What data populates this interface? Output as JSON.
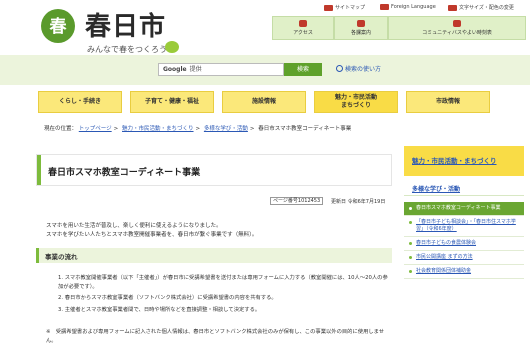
{
  "header": {
    "logo_glyph": "春",
    "title": "春日市",
    "tagline": "みんなで春をつくろう",
    "top_links": [
      {
        "label": "サイトマップ",
        "icon": "sitemap-icon"
      },
      {
        "label": "Foreign Language",
        "icon": "globe-icon"
      },
      {
        "label": "文字サイズ・配色の変更",
        "icon": "text-size-icon"
      }
    ],
    "top_buttons": [
      {
        "label": "アクセス",
        "icon": "map-pin-icon"
      },
      {
        "label": "各課案内",
        "icon": "building-icon"
      },
      {
        "label": "コミュニティバスやよい時刻表",
        "icon": "bus-icon"
      }
    ]
  },
  "search": {
    "brand": "Google",
    "placeholder": "提供",
    "button_label": "検索",
    "help_label": "検索の使い方"
  },
  "nav": [
    {
      "label": "くらし・手続き",
      "active": false
    },
    {
      "label": "子育て・健康・福祉",
      "active": false
    },
    {
      "label": "施設情報",
      "active": false
    },
    {
      "label": "魅力・市民活動\nまちづくり",
      "active": true
    },
    {
      "label": "市政情報",
      "active": false
    }
  ],
  "breadcrumb": {
    "prefix": "現在の位置：",
    "items": [
      "トップページ",
      "魅力・市民活動・まちづくり",
      "多様な学び・活動",
      "春日市スマホ教室コーディネート事業"
    ]
  },
  "main": {
    "title": "春日市スマホ教室コーディネート事業",
    "page_id": "ページ番号1012453",
    "updated": "更新日 令和6年7月19日",
    "intro_lines": [
      "スマホを用いた生活が普及し、楽しく便利に使えるようになりました。",
      "スマホを学びたい人たちとスマホ教室開催事業者を、春日市が繋ぐ事業です（無料）。"
    ],
    "section_heading": "事業の流れ",
    "steps": [
      "1. スマホ教室開催事業者（以下「主催者」）が春日市に受講希望書を送付または専用フォームに入力する（教室開催には、10人～20人の参加が必要です）。",
      "2. 春日市からスマホ教室事業者（ソフトバンク株式会社）に受講希望書の内容を共有する。",
      "3. 主催者とスマホ教室事業者間で、日時や場所などを直接調整・相談して決定する。"
    ],
    "note": "※　受講希望書および専用フォームに記入された個人情報は、春日市とソフトバンク株式会社のみが保有し、この事業以外の目的に使用しません。"
  },
  "sidebar": {
    "heading": "魅力・市民活動・まちづくり",
    "subheading": "多様な学び・活動",
    "links": [
      {
        "label": "春日市スマホ教室コーディネート事業",
        "current": true
      },
      {
        "label": "「春日市子ども相談会」・「春日市住スマホ学習」（令和6年度）",
        "current": false
      },
      {
        "label": "春日市子どもの食農体験会",
        "current": false
      },
      {
        "label": "市民公開講座 まずの方法",
        "current": false
      },
      {
        "label": "社会教育関係団体補助金",
        "current": false
      }
    ]
  },
  "colors": {
    "brand_green": "#5a9a2c",
    "nav_yellow": "#fbe87a",
    "link_blue": "#2b58b5",
    "accent_red": "#c0392b"
  }
}
